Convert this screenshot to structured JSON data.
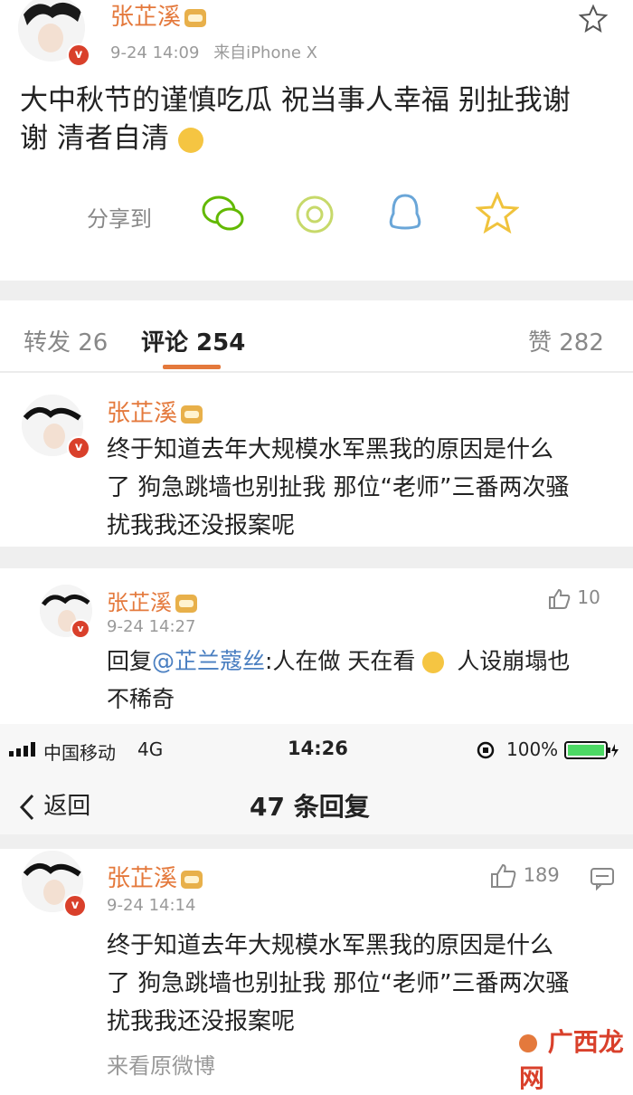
{
  "post": {
    "author": "张芷溪",
    "time": "9-24 14:09",
    "source": "来自iPhone X",
    "text_line1": "大中秋节的谨慎吃瓜 祝当事人幸福 别扯我谢",
    "text_line2": "谢 清者自清",
    "share_label": "分享到",
    "share_icons": [
      "wechat-icon",
      "moments-icon",
      "qq-icon",
      "qzone-icon"
    ]
  },
  "tabs": {
    "repost": "转发 26",
    "comment": "评论 254",
    "like": "赞 282"
  },
  "comment1": {
    "author": "张芷溪",
    "line1": "终于知道去年大规模水军黑我的原因是什么",
    "line2": "了 狗急跳墙也别扯我 那位“老师”三番两次骚",
    "line3": "扰我我还没报案呢"
  },
  "reply1": {
    "author": "张芷溪",
    "time": "9-24 14:27",
    "likes": "10",
    "prefix": "回复",
    "mention": "@芷兰蔻丝",
    "text_a": ":人在做 天在看",
    "text_b": "人设崩塌也",
    "line2": "不稀奇"
  },
  "status_bar": {
    "carrier": "中国移动",
    "network": "4G",
    "time": "14:26",
    "battery": "100%"
  },
  "nav": {
    "back": "返回",
    "title": "47 条回复"
  },
  "comment2": {
    "author": "张芷溪",
    "time": "9-24 14:14",
    "likes": "189",
    "line1": "终于知道去年大规模水军黑我的原因是什么",
    "line2": "了 狗急跳墙也别扯我 那位“老师”三番两次骚",
    "line3": "扰我我还没报案呢",
    "partial": "来看原微博"
  },
  "watermark": {
    "text": "广西龙网"
  },
  "colors": {
    "name": "#e4793c",
    "mention": "#4a7fc1",
    "tab_underline": "#e4793c",
    "battery": "#4cd964"
  }
}
